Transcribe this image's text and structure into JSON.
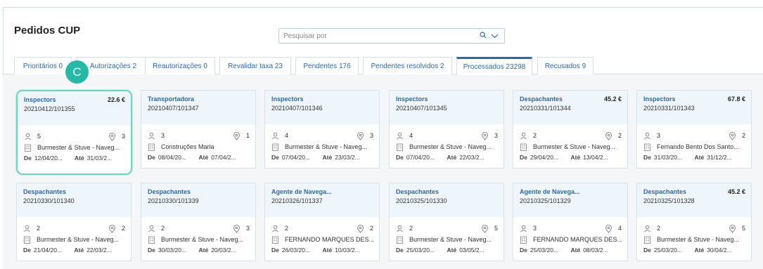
{
  "page": {
    "title": "Pedidos CUP"
  },
  "search": {
    "placeholder": "Pesquisar por"
  },
  "tabs": [
    {
      "label": "Prioritários 0",
      "active": false
    },
    {
      "label": "Autorizações 2",
      "active": false
    },
    {
      "label": "Reautorizações 0",
      "active": false
    },
    {
      "label": "Revalidar taxa 23",
      "active": false
    },
    {
      "label": "Pendentes 176",
      "active": false
    },
    {
      "label": "Pendentes resolvidos 2",
      "active": false
    },
    {
      "label": "Processados 23298",
      "active": true
    },
    {
      "label": "Recusados 9",
      "active": false
    }
  ],
  "badge": {
    "letter": "C",
    "color": "#28b8a8"
  },
  "colors": {
    "accent": "#2d6aa6",
    "selected_border": "#6fd3c3",
    "card_header": "#eef5fb"
  },
  "labels": {
    "from": "De",
    "to": "Até"
  },
  "cards": [
    {
      "type": "Inspectors",
      "id": "20210412/101355",
      "amount": "22.6 €",
      "count_people": "5",
      "count_places": "3",
      "company": "Burmester & Stuve - Naveg...",
      "from": "12/04/20...",
      "to": "31/03/2...",
      "selected": true
    },
    {
      "type": "Transportadora",
      "id": "20210407/101347",
      "amount": "",
      "count_people": "3",
      "count_places": "1",
      "company": "Construções Maria",
      "from": "08/04/20...",
      "to": "07/04/2...",
      "selected": false
    },
    {
      "type": "Inspectors",
      "id": "20210407/101346",
      "amount": "",
      "count_people": "4",
      "count_places": "3",
      "company": "Burmester & Stuve - Naveg...",
      "from": "07/04/20...",
      "to": "23/03/2...",
      "selected": false
    },
    {
      "type": "Inspectors",
      "id": "20210407/101345",
      "amount": "",
      "count_people": "4",
      "count_places": "3",
      "company": "Burmester & Stuve - Naveg...",
      "from": "07/04/20...",
      "to": "22/03/2...",
      "selected": false
    },
    {
      "type": "Despachantes",
      "id": "20210331/101344",
      "amount": "45.2 €",
      "count_people": "2",
      "count_places": "2",
      "company": "Burmester & Stuve - Naveg...",
      "from": "29/04/20...",
      "to": "13/04/2...",
      "selected": false
    },
    {
      "type": "Inspectors",
      "id": "20210331/101343",
      "amount": "67.8 €",
      "count_people": "3",
      "count_places": "2",
      "company": "Fernando Bento Dos Santo...",
      "from": "31/03/20...",
      "to": "31/12/2...",
      "selected": false
    },
    {
      "type": "Despachantes",
      "id": "20210330/101340",
      "amount": "",
      "count_people": "2",
      "count_places": "2",
      "company": "Burmester & Stuve - Naveg...",
      "from": "21/04/20...",
      "to": "22/03/2...",
      "selected": false
    },
    {
      "type": "Despachantes",
      "id": "20210330/101339",
      "amount": "",
      "count_people": "2",
      "count_places": "3",
      "company": "Burmester & Stuve - Naveg...",
      "from": "30/03/20...",
      "to": "20/03/2...",
      "selected": false
    },
    {
      "type": "Agente de Navega...",
      "id": "20210326/101337",
      "amount": "",
      "count_people": "2",
      "count_places": "2",
      "company": "FERNANDO MARQUES DES...",
      "from": "26/03/20...",
      "to": "10/03/2...",
      "selected": false
    },
    {
      "type": "Despachantes",
      "id": "20210325/101330",
      "amount": "",
      "count_people": "2",
      "count_places": "5",
      "company": "Burmester & Stuve - Naveg...",
      "from": "25/03/20...",
      "to": "03/05/2...",
      "selected": false
    },
    {
      "type": "Agente de Navega...",
      "id": "20210325/101329",
      "amount": "",
      "count_people": "3",
      "count_places": "4",
      "company": "FERNANDO MARQUES DES...",
      "from": "25/03/20...",
      "to": "08/03/2...",
      "selected": false
    },
    {
      "type": "Despachantes",
      "id": "20210325/101328",
      "amount": "45.2 €",
      "count_people": "2",
      "count_places": "5",
      "company": "Burmester & Stuve - Naveg...",
      "from": "25/03/20...",
      "to": "30/04/2...",
      "selected": false
    }
  ]
}
